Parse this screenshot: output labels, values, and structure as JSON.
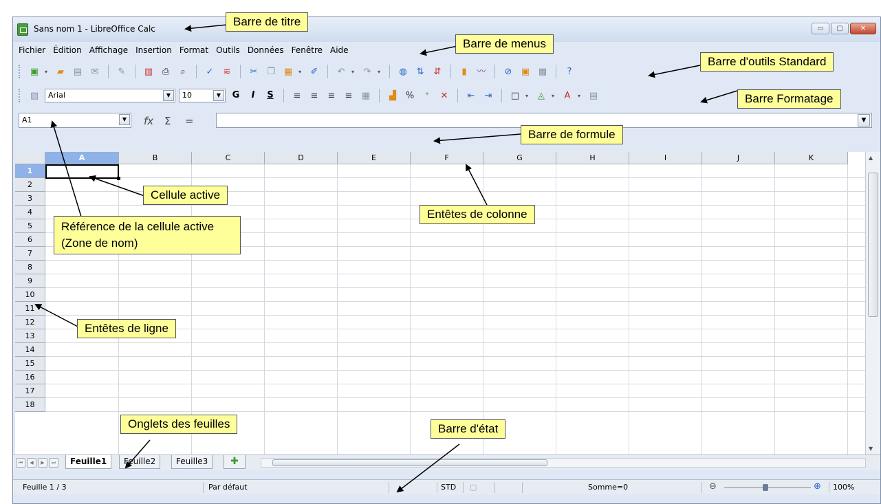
{
  "window": {
    "title": "Sans nom 1 - LibreOffice Calc",
    "buttons": {
      "minimize": "▭",
      "maximize": "▢",
      "close": "✕"
    }
  },
  "menu": [
    "Fichier",
    "Édition",
    "Affichage",
    "Insertion",
    "Format",
    "Outils",
    "Données",
    "Fenêtre",
    "Aide"
  ],
  "format_toolbar": {
    "font_name": "Arial",
    "font_size": "10",
    "bold": "G",
    "italic": "I",
    "underline": "S"
  },
  "formula_bar": {
    "name_box": "A1",
    "function_wizard_icon": "fx",
    "sum_icon": "Σ",
    "equals_icon": "="
  },
  "grid": {
    "columns": [
      "A",
      "B",
      "C",
      "D",
      "E",
      "F",
      "G",
      "H",
      "I",
      "J",
      "K"
    ],
    "rows": [
      "1",
      "2",
      "3",
      "4",
      "5",
      "6",
      "7",
      "8",
      "9",
      "10",
      "11",
      "12",
      "13",
      "14",
      "15",
      "16",
      "17",
      "18"
    ],
    "active_column": "A",
    "active_row": "1"
  },
  "sheets": {
    "tabs": [
      "Feuille1",
      "Feuille2",
      "Feuille3"
    ],
    "active": "Feuille1"
  },
  "status_bar": {
    "sheet_position": "Feuille 1 / 3",
    "page_style": "Par défaut",
    "selection_mode": "STD",
    "sum": "Somme=0",
    "zoom": "100%"
  },
  "annotations": {
    "title_bar": "Barre de titre",
    "menu_bar": "Barre de menus",
    "standard_toolbar": "Barre d'outils Standard",
    "format_toolbar": "Barre Formatage",
    "formula_bar": "Barre de formule",
    "active_cell": "Cellule active",
    "column_headers": "Entêtes de colonne",
    "name_box": "Référence de la cellule active (Zone de nom)",
    "row_headers": "Entêtes de ligne",
    "sheet_tabs": "Onglets des feuilles",
    "status_bar": "Barre d'état"
  }
}
